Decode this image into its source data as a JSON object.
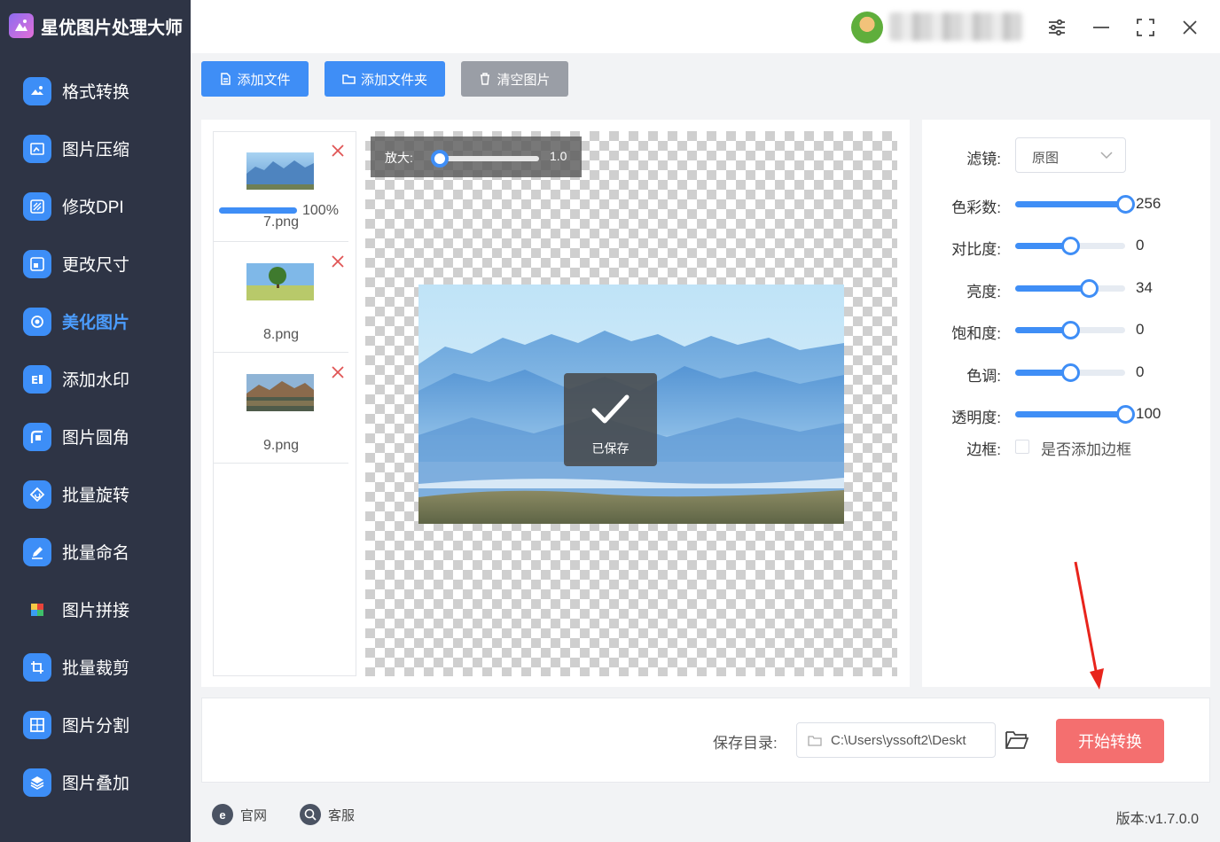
{
  "app": {
    "title": "星优图片处理大师"
  },
  "sidebar": {
    "items": [
      {
        "label": "格式转换",
        "icon": "image-convert-icon",
        "color": "#3d8ef7"
      },
      {
        "label": "图片压缩",
        "icon": "image-compress-icon",
        "color": "#3d8ef7"
      },
      {
        "label": "修改DPI",
        "icon": "dpi-icon",
        "color": "#3d8ef7"
      },
      {
        "label": "更改尺寸",
        "icon": "resize-icon",
        "color": "#3d8ef7"
      },
      {
        "label": "美化图片",
        "icon": "beautify-icon",
        "color": "#3d8ef7",
        "active": true
      },
      {
        "label": "添加水印",
        "icon": "watermark-icon",
        "color": "#3d8ef7"
      },
      {
        "label": "图片圆角",
        "icon": "round-corner-icon",
        "color": "#3d8ef7"
      },
      {
        "label": "批量旋转",
        "icon": "rotate-icon",
        "color": "#3d8ef7"
      },
      {
        "label": "批量命名",
        "icon": "rename-icon",
        "color": "#3d8ef7"
      },
      {
        "label": "图片拼接",
        "icon": "puzzle-icon",
        "color": "#3d8ef7"
      },
      {
        "label": "批量裁剪",
        "icon": "crop-icon",
        "color": "#3d8ef7"
      },
      {
        "label": "图片分割",
        "icon": "split-icon",
        "color": "#3d8ef7"
      },
      {
        "label": "图片叠加",
        "icon": "layers-icon",
        "color": "#3d8ef7"
      }
    ]
  },
  "toolbar": {
    "add_file": "添加文件",
    "add_folder": "添加文件夹",
    "clear": "清空图片"
  },
  "files": [
    {
      "name": "7.png",
      "progress": 100,
      "progress_label": "100%"
    },
    {
      "name": "8.png"
    },
    {
      "name": "9.png"
    }
  ],
  "preview": {
    "zoom_label": "放大:",
    "zoom_value": "1.0",
    "saved_text": "已保存"
  },
  "settings": {
    "filter": {
      "label": "滤镜:",
      "value": "原图"
    },
    "sliders": [
      {
        "label": "色彩数:",
        "value": 256,
        "min": 0,
        "max": 256
      },
      {
        "label": "对比度:",
        "value": 0,
        "min": -100,
        "max": 100
      },
      {
        "label": "亮度:",
        "value": 34,
        "min": -100,
        "max": 100
      },
      {
        "label": "饱和度:",
        "value": 0,
        "min": -100,
        "max": 100
      },
      {
        "label": "色调:",
        "value": 0,
        "min": -100,
        "max": 100
      },
      {
        "label": "透明度:",
        "value": 100,
        "min": 0,
        "max": 100
      }
    ],
    "border": {
      "label": "边框:",
      "checkbox_label": "是否添加边框",
      "checked": false
    }
  },
  "save": {
    "label": "保存目录:",
    "path": "C:\\Users\\yssoft2\\Deskt",
    "start_button": "开始转换"
  },
  "footer": {
    "website": "官网",
    "support": "客服",
    "version": "版本:v1.7.0.0"
  },
  "colors": {
    "accent": "#3f8ef6",
    "sidebar_bg": "#2e3445",
    "start_button": "#f46f6f",
    "clear_button": "#9a9ea6"
  }
}
